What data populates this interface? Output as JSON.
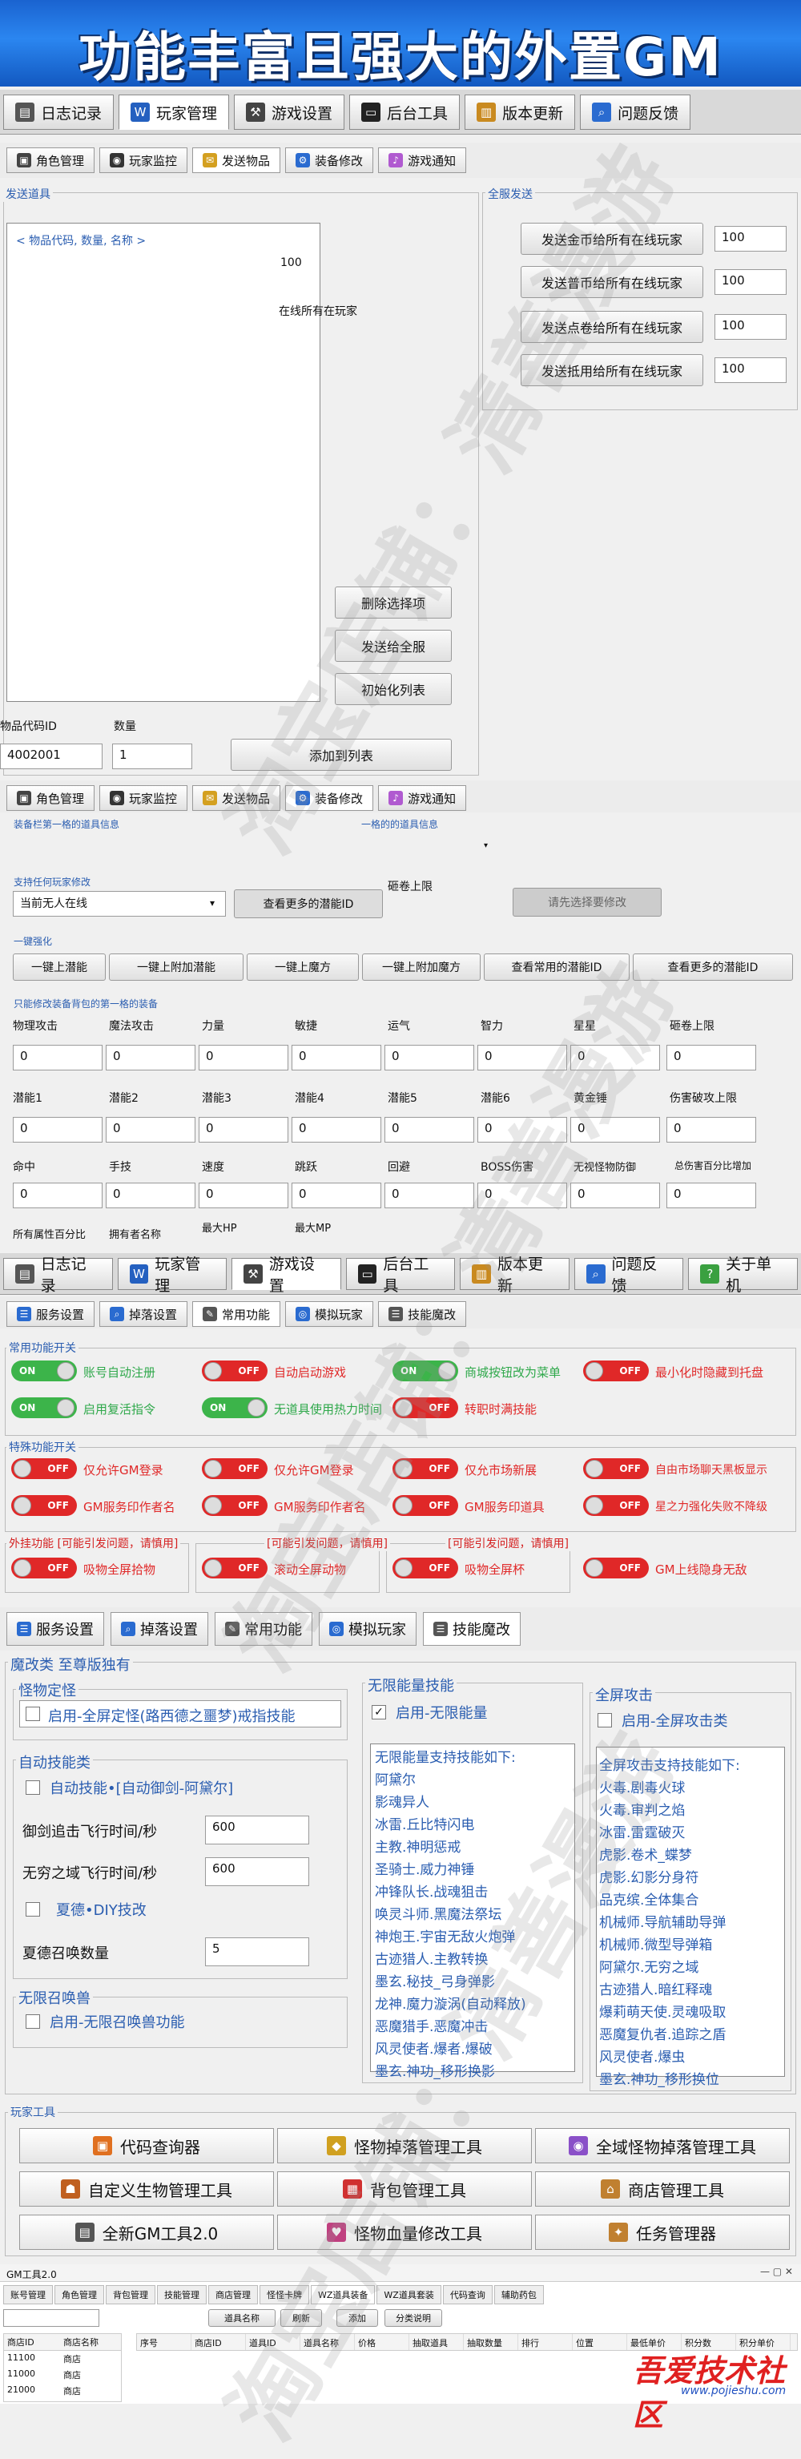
{
  "banner_title": "功能丰富且强大的外置GM",
  "main_tabs": [
    "日志记录",
    "玩家管理",
    "游戏设置",
    "后台工具",
    "版本更新",
    "问题反馈",
    "关于单机"
  ],
  "sub_tabs_1": [
    "角色管理",
    "玩家监控",
    "发送物品",
    "装备修改",
    "游戏通知"
  ],
  "send_items": {
    "legend": "发送道具",
    "list_header": "< 物品代码, 数量, 名称 >",
    "qty_value": "100",
    "online_text": "在线所有在玩家",
    "delete_btn": "删除选择项",
    "send_all_btn": "发送给全服",
    "init_btn": "初始化列表",
    "id_label": "物品代码ID",
    "qty_label": "数量",
    "id_value": "4002001",
    "qty_input": "1",
    "add_btn": "添加到列表"
  },
  "server_send": {
    "legend": "全服发送",
    "rows": [
      {
        "label": "发送金币给所有在线玩家",
        "value": "100"
      },
      {
        "label": "发送普币给所有在线玩家",
        "value": "100"
      },
      {
        "label": "发送点卷给所有在线玩家",
        "value": "100"
      },
      {
        "label": "发送抵用给所有在线玩家",
        "value": "100"
      }
    ]
  },
  "sub_tabs_2": [
    "角色管理",
    "玩家监控",
    "发送物品",
    "装备修改",
    "游戏通知"
  ],
  "equip": {
    "legend1": "装备栏第一格的道具信息",
    "legend2": "一格的的道具信息",
    "player_legend": "支持任何玩家修改",
    "player_select": "当前无人在线",
    "more_btn": "查看更多的潜能ID",
    "scroll_label": "砸卷上限",
    "tab_btn": "请先选择要修改",
    "onekey_legend": "一键强化",
    "onekey_btns": [
      "一键上潜能",
      "一键上附加潜能",
      "一键上魔方",
      "一键上附加魔方",
      "查看常用的潜能ID",
      "查看更多的潜能ID"
    ],
    "bag_legend": "只能修改装备背包的第一格的装备",
    "row1": [
      "物理攻击",
      "魔法攻击",
      "力量",
      "敏捷",
      "运气",
      "智力",
      "星星",
      "砸卷上限"
    ],
    "row2": [
      "潜能1",
      "潜能2",
      "潜能3",
      "潜能4",
      "潜能5",
      "潜能6",
      "黄金锤",
      "伤害破攻上限"
    ],
    "row3": [
      "命中",
      "手技",
      "速度",
      "跳跃",
      "回避",
      "BOSS伤害",
      "无视怪物防御",
      "总伤害百分比增加"
    ],
    "row4": [
      "所有属性百分比",
      "拥有者名称",
      "最大HP",
      "最大MP"
    ],
    "zero": "0"
  },
  "sub_tabs_3": [
    "服务设置",
    "掉落设置",
    "常用功能",
    "模拟玩家",
    "技能魔改"
  ],
  "common": {
    "legend": "常用功能开关",
    "rows": [
      [
        {
          "state": "ON",
          "label": "账号自动注册"
        },
        {
          "state": "OFF",
          "label": "自动启动游戏"
        },
        {
          "state": "ON",
          "label": "商城按钮改为菜单"
        },
        {
          "state": "OFF",
          "label": "最小化时隐藏到托盘"
        }
      ],
      [
        {
          "state": "ON",
          "label": "启用复活指令"
        },
        {
          "state": "ON",
          "label": "无道具使用热力时间"
        },
        {
          "state": "OFF",
          "label": "转职时满技能"
        }
      ]
    ],
    "special_legend": "特殊功能开关",
    "special_rows": [
      [
        {
          "state": "OFF",
          "label": "仅允许GM登录"
        },
        {
          "state": "OFF",
          "label": "仅允许GM登录"
        },
        {
          "state": "OFF",
          "label": "仅允市场新展"
        },
        {
          "state": "OFF",
          "label": "自由市场聊天黑板显示"
        }
      ],
      [
        {
          "state": "OFF",
          "label": "GM服务印作者名"
        },
        {
          "state": "OFF",
          "label": "GM服务印作者名"
        },
        {
          "state": "OFF",
          "label": "GM服务印道具"
        },
        {
          "state": "OFF",
          "label": "星之力强化失败不降级"
        }
      ]
    ],
    "plugin_legend": "外挂功能 [可能引发问题，请慎用]",
    "plugin_legend2": "[可能引发问题，请慎用]",
    "plugin_legend3": "[可能引发问题，请慎用]",
    "plugin_row": [
      {
        "state": "OFF",
        "label": "吸物全屏拾物"
      },
      {
        "state": "OFF",
        "label": "滚动全屏动物"
      },
      {
        "state": "OFF",
        "label": "吸物全屏杯"
      },
      {
        "state": "OFF",
        "label": "GM上线隐身无敌"
      }
    ]
  },
  "sub_tabs_4": [
    "服务设置",
    "掉落设置",
    "常用功能",
    "模拟玩家",
    "技能魔改"
  ],
  "skills": {
    "group_title": "魔改类 至尊版独有",
    "lock_legend": "怪物定怪",
    "lock_chk": "启用-全屏定怪(路西德之噩梦)戒指技能",
    "auto_legend": "自动技能类",
    "auto_chk": "自动技能•[自动御剑-阿黛尔]",
    "sword_label": "御剑追击飞行时间/秒",
    "sword_value": "600",
    "infinite_label": "无穷之域飞行时间/秒",
    "infinite_value": "600",
    "summer_chk": "夏德•DIY技改",
    "summon_label": "夏德召唤数量",
    "summon_value": "5",
    "nolimit_legend": "无限召唤兽",
    "nolimit_chk": "启用-无限召唤兽功能",
    "energy_legend": "无限能量技能",
    "energy_chk": "启用-无限能量",
    "energy_list": [
      "无限能量支持技能如下:",
      "阿黛尔",
      "影魂异人",
      "冰雷.丘比特闪电",
      "主教.神明惩戒",
      "圣骑士.威力神锤",
      "冲锋队长.战魂狙击",
      "唤灵斗师.黑魔法祭坛",
      "神炮王.宇宙无敌火炮弹",
      "古迹猎人.主教转换",
      "墨玄.秘技_弓身弹影",
      "龙神.魔力漩涡(自动释放)",
      "恶魔猎手.恶魔冲击",
      "风灵使者.爆者.爆破",
      "墨玄.神功_移形换影"
    ],
    "screen_legend": "全屏攻击",
    "screen_chk": "启用-全屏攻击类",
    "screen_list": [
      "全屏攻击支持技能如下:",
      "火毒.剧毒火球",
      "火毒.审判之焰",
      "冰雷.雷霆破灭",
      "虎影.卷术_蝶梦",
      "虎影.幻影分身符",
      "品克缤.全体集合",
      "机械师.导航辅助导弹",
      "机械师.微型导弹箱",
      "阿黛尔.无穷之域",
      "古迹猎人.暗红释魂",
      "爆莉萌天使.灵魂吸取",
      "恶魔复仇者.追踪之盾",
      "风灵使者.爆虫",
      "墨玄.神功_移形换位"
    ]
  },
  "tools": {
    "legend": "玩家工具",
    "buttons": [
      "代码查询器",
      "怪物掉落管理工具",
      "全域怪物掉落管理工具",
      "自定义生物管理工具",
      "背包管理工具",
      "商店管理工具",
      "全新GM工具2.0",
      "怪物血量修改工具",
      "任务管理器"
    ]
  },
  "mini": {
    "title": "GM工具2.0",
    "tabs": [
      "账号管理",
      "角色管理",
      "背包管理",
      "技能管理",
      "商店管理",
      "怪怪卡牌",
      "WZ道具装备",
      "WZ道具套装",
      "代码查询",
      "辅助药包"
    ],
    "search_btn": "道具名称",
    "refresh_btn": "刷新",
    "add_btn": "添加",
    "classify_btn": "分类说明",
    "left_headers": [
      "商店ID",
      "商店名称"
    ],
    "left_rows": [
      [
        "11100",
        "商店"
      ],
      [
        "11000",
        "商店"
      ],
      [
        "21000",
        "商店"
      ]
    ],
    "headers": [
      "序号",
      "商店ID",
      "道具ID",
      "道具名称",
      "价格",
      "抽取道具",
      "抽取数量",
      "排行",
      "位置",
      "最低单价",
      "积分数",
      "积分单价"
    ]
  },
  "site_watermark": "吾爱技术社区",
  "site_url": "www.pojieshu.com",
  "watermark_text": "淘宝店铺：清善漫游"
}
